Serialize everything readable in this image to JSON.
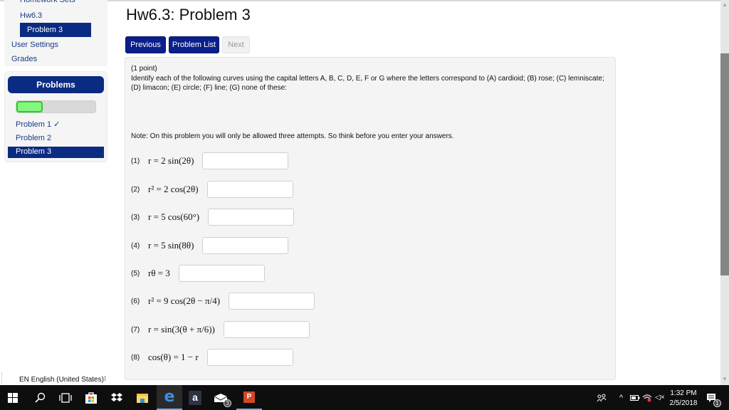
{
  "sidebar": {
    "homework_sets": "Homework Sets",
    "set_name": "Hw6.3",
    "current_problem": "Problem 3",
    "user_settings": "User Settings",
    "grades": "Grades",
    "problems_header": "Problems",
    "progress_fraction": 0.33,
    "problems": [
      {
        "label": "Problem 1 ✓",
        "active": false
      },
      {
        "label": "Problem 2",
        "active": false
      },
      {
        "label": "Problem 3",
        "active": true
      }
    ]
  },
  "main": {
    "title": "Hw6.3: Problem 3",
    "buttons": {
      "previous": "Previous",
      "problem_list": "Problem List",
      "next": "Next"
    },
    "points": "(1 point)",
    "instructions_line1": "Identify each of the following curves using the capital letters A, B, C, D, E, F or G where the letters correspond to (A) cardioid; (B) rose; (C) lemniscate;",
    "instructions_line2": "(D) limacon; (E) circle; (F) line; (G) none of these:",
    "note": "Note: On this problem you will only be allowed three attempts. So think before you enter your answers.",
    "questions": [
      {
        "num": "(1)",
        "expr": "r = 2 sin(2θ)",
        "value": ""
      },
      {
        "num": "(2)",
        "expr": "r² = 2 cos(2θ)",
        "value": ""
      },
      {
        "num": "(3)",
        "expr": "r = 5 cos(60°)",
        "value": ""
      },
      {
        "num": "(4)",
        "expr": "r = 5 sin(8θ)",
        "value": ""
      },
      {
        "num": "(5)",
        "expr": "rθ = 3",
        "value": ""
      },
      {
        "num": "(6)",
        "expr": "r² = 9 cos(2θ − π/4)",
        "value": ""
      },
      {
        "num": "(7)",
        "expr": "r = sin(3(θ + π/6))",
        "value": ""
      },
      {
        "num": "(8)",
        "expr": "cos(θ) = 1 − r",
        "value": ""
      }
    ]
  },
  "language_bar": {
    "label": "EN English (United States)",
    "arrow": "⁝"
  },
  "taskbar": {
    "icons": [
      "windows-start",
      "search",
      "task-view",
      "store",
      "dropbox",
      "file-explorer",
      "edge",
      "amazon",
      "mail",
      "powerpoint"
    ],
    "mail_badge": "3",
    "notification_badge": "1",
    "time": "1:32 PM",
    "date": "2/5/2018"
  },
  "colors": {
    "brand_blue": "#0b2b82",
    "progress_green": "#86f77e"
  }
}
